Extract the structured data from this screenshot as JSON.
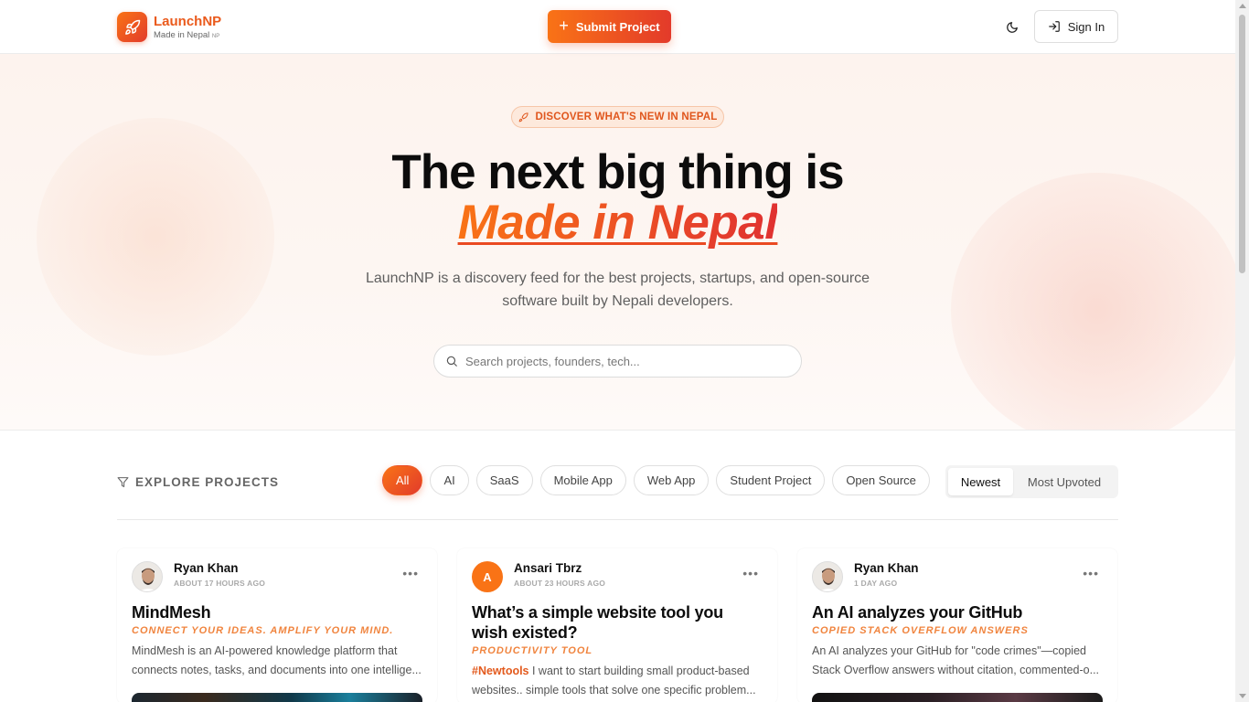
{
  "header": {
    "brand_name": "LaunchNP",
    "brand_sub": "Made in Nepal",
    "brand_sub_flag": "NP",
    "submit_label": "Submit Project",
    "signin_label": "Sign In",
    "icons": {
      "logo": "rocket-icon",
      "theme": "moon-icon",
      "signin": "sign-in-icon",
      "submit": "plus-icon"
    }
  },
  "hero": {
    "badge": "DISCOVER WHAT'S NEW IN NEPAL",
    "title_line1": "The next big thing is",
    "title_line2": "Made in Nepal",
    "description": "LaunchNP is a discovery feed for the best projects, startups, and open-source software built by Nepali developers.",
    "search_placeholder": "Search projects, founders, tech..."
  },
  "explore": {
    "label": "EXPLORE PROJECTS",
    "categories": [
      "All",
      "AI",
      "SaaS",
      "Mobile App",
      "Web App",
      "Student Project",
      "Open Source"
    ],
    "active_category": "All",
    "sort_options": [
      "Newest",
      "Most Upvoted"
    ],
    "active_sort": "Newest"
  },
  "cards": [
    {
      "author": "Ryan Khan",
      "time": "ABOUT 17 HOURS AGO",
      "avatar": "photo",
      "title": "MindMesh",
      "tagline": "CONNECT YOUR IDEAS. AMPLIFY YOUR MIND.",
      "hashtag": "",
      "description": "MindMesh is an AI-powered knowledge platform that connects notes, tasks, and documents into one intellige..."
    },
    {
      "author": "Ansari Tbrz",
      "time": "ABOUT 23 HOURS AGO",
      "avatar_letter": "A",
      "title": "What’s a simple website tool you wish existed?",
      "tagline": "PRODUCTIVITY TOOL",
      "hashtag": "#Newtools",
      "description": " I want to start building small product-based websites.. simple tools that solve one specific problem..."
    },
    {
      "author": "Ryan Khan",
      "time": "1 DAY AGO",
      "avatar": "photo",
      "title": "An AI analyzes your GitHub",
      "tagline": "COPIED STACK OVERFLOW ANSWERS",
      "hashtag": "",
      "description": "An AI analyzes your GitHub for \"code crimes\"—copied Stack Overflow answers without citation, commented-o..."
    }
  ],
  "colors": {
    "accent_start": "#f97316",
    "accent_end": "#e23b2b",
    "tag": "#f0843e"
  }
}
